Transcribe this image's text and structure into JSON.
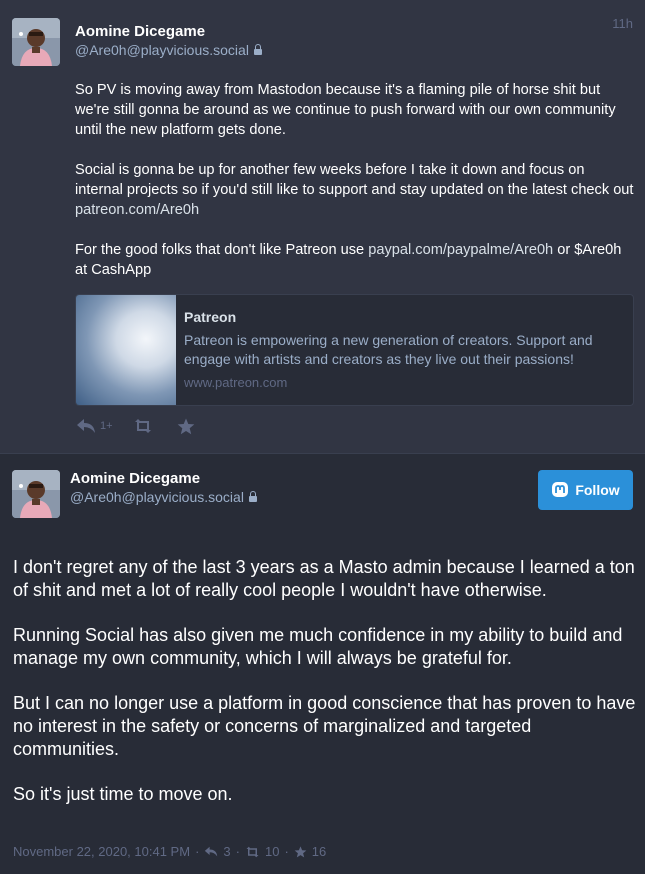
{
  "status1": {
    "display_name": "Aomine Dicegame",
    "account": "@Are0h@playvicious.social",
    "time": "11h",
    "paragraphs": [
      {
        "text": "So PV is moving away from Mastodon because it's a flaming pile of horse shit but we're still gonna be around as we continue to push forward with our own community until the new platform gets done."
      },
      {
        "text_before": "Social is gonna be up for another few weeks before I take it down and focus on internal projects so if you'd still like to support and stay updated on the latest check out ",
        "link": "patreon.com/Are0h"
      },
      {
        "text_before": "For the good folks that don't like Patreon use ",
        "link": "paypal.com/paypalme/Are0h",
        "text_after": " or $Are0h at CashApp"
      }
    ],
    "card": {
      "title": "Patreon",
      "description": "Patreon is empowering a new generation of creators. Support and engage with artists and creators as they live out their passions!",
      "host": "www.patreon.com"
    },
    "actions": {
      "reply_count": "1+",
      "reply_icon": "reply-icon",
      "boost_icon": "boost-icon",
      "favourite_icon": "star-icon"
    }
  },
  "status2": {
    "display_name": "Aomine Dicegame",
    "account": "@Are0h@playvicious.social",
    "follow_label": "Follow",
    "paragraphs": [
      "I don't regret any of the last 3 years as a Masto admin because I learned a ton of shit and met a lot of really cool people I wouldn't have otherwise.",
      "Running Social has also given me much confidence in my ability to build and manage my own community, which I will always be grateful for.",
      "But I can no longer use a platform in good conscience that has proven to have no interest in the safety or concerns of marginalized and targeted communities.",
      "So it's just time to move on."
    ],
    "meta": {
      "date": "November 22, 2020, 10:41 PM",
      "replies": "3",
      "boosts": "10",
      "favourites": "16"
    }
  },
  "colors": {
    "accent": "#2b90d9",
    "link": "#8c8dff",
    "muted": "#606984",
    "background": "#282c37"
  }
}
